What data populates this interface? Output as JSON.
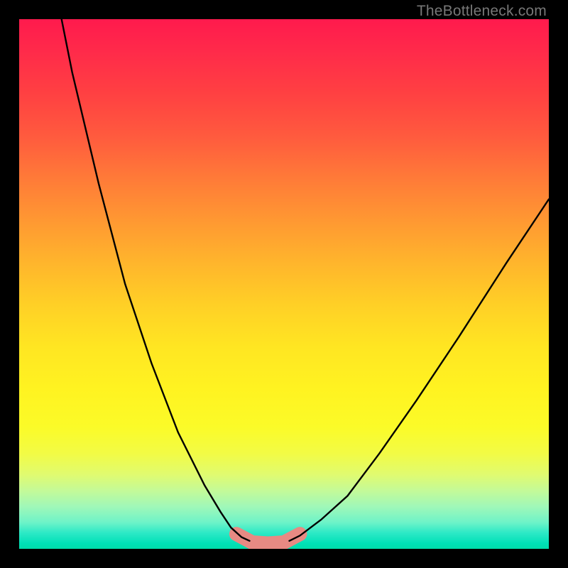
{
  "watermark": "TheBottleneck.com",
  "chart_data": {
    "type": "line",
    "title": "",
    "xlabel": "",
    "ylabel": "",
    "xlim": [
      0,
      100
    ],
    "ylim": [
      0,
      100
    ],
    "series": [
      {
        "name": "left-curve",
        "x": [
          8,
          10,
          15,
          20,
          25,
          30,
          35,
          38,
          40,
          42,
          43.5
        ],
        "y": [
          100,
          90,
          69,
          50,
          35,
          22,
          12,
          7,
          4,
          2.2,
          1.5
        ]
      },
      {
        "name": "right-curve",
        "x": [
          51,
          53,
          57,
          62,
          68,
          75,
          83,
          92,
          100
        ],
        "y": [
          1.5,
          2.5,
          5.5,
          10,
          18,
          28,
          40,
          54,
          66
        ]
      },
      {
        "name": "floor-marker",
        "x": [
          41,
          44,
          47,
          50,
          53
        ],
        "y": [
          2.8,
          1.2,
          1.0,
          1.2,
          2.8
        ]
      }
    ],
    "colors": {
      "curve": "#000000",
      "marker": "#e78a83",
      "gradient_top": "#ff1a4d",
      "gradient_bottom": "#00dca9"
    }
  }
}
